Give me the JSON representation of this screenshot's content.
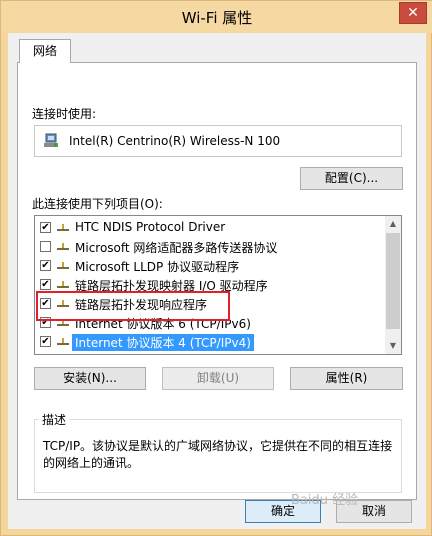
{
  "window": {
    "title": "Wi-Fi 属性",
    "close_symbol": "✕"
  },
  "tabs": [
    {
      "label": "网络"
    }
  ],
  "connect_using": {
    "label": "连接时使用:",
    "adapter": "Intel(R) Centrino(R) Wireless-N 100",
    "configure_button": "配置(C)..."
  },
  "items_section": {
    "label": "此连接使用下列项目(O):"
  },
  "items": [
    {
      "label": "HTC NDIS Protocol Driver",
      "checked": true
    },
    {
      "label": "Microsoft 网络适配器多路传送器协议",
      "checked": false
    },
    {
      "label": "Microsoft LLDP 协议驱动程序",
      "checked": true
    },
    {
      "label": "链路层拓扑发现映射器 I/O 驱动程序",
      "checked": true
    },
    {
      "label": "链路层拓扑发现响应程序",
      "checked": true
    },
    {
      "label": "Internet 协议版本 6 (TCP/IPv6)",
      "checked": true
    },
    {
      "label": "Internet 协议版本 4 (TCP/IPv4)",
      "checked": true,
      "selected": true
    }
  ],
  "actions": {
    "install": "安装(N)...",
    "uninstall": "卸载(U)",
    "properties": "属性(R)"
  },
  "description": {
    "title": "描述",
    "text": "TCP/IP。该协议是默认的广域网络协议，它提供在不同的相互连接的网络上的通讯。"
  },
  "footer": {
    "ok": "确定",
    "cancel": "取消"
  },
  "watermark": {
    "text": "Baidu 经验"
  },
  "colors": {
    "selection": "#3399ff",
    "highlight_frame": "#e0212a",
    "title_bar": "#f6d9a2"
  }
}
